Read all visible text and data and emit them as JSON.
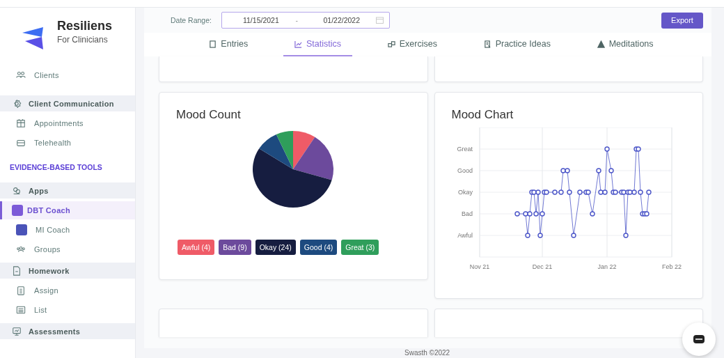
{
  "brand": {
    "name": "Resiliens",
    "subtitle": "For Clinicians"
  },
  "sidebar": {
    "items": [
      {
        "kind": "item",
        "label": "Clients",
        "selected": false
      },
      {
        "kind": "section",
        "label": "Client Communication",
        "selected": false
      },
      {
        "kind": "item",
        "label": "Appointments",
        "selected": false
      },
      {
        "kind": "item",
        "label": "Telehealth",
        "selected": false
      },
      {
        "kind": "heading",
        "label": "EVIDENCE-BASED TOOLS"
      },
      {
        "kind": "section",
        "label": "Apps",
        "selected": false
      },
      {
        "kind": "item",
        "label": "DBT Coach",
        "selected": true
      },
      {
        "kind": "item",
        "label": "MI Coach",
        "selected": false
      },
      {
        "kind": "item",
        "label": "Groups",
        "selected": false
      },
      {
        "kind": "section",
        "label": "Homework",
        "selected": false
      },
      {
        "kind": "item",
        "label": "Assign",
        "selected": false
      },
      {
        "kind": "item",
        "label": "List",
        "selected": false
      },
      {
        "kind": "section",
        "label": "Assessments",
        "selected": false
      }
    ]
  },
  "filter": {
    "label": "Date Range:",
    "start": "11/15/2021",
    "separator": "-",
    "end": "01/22/2022"
  },
  "export_button": "Export",
  "tabs": [
    {
      "label": "Entries",
      "selected": false
    },
    {
      "label": "Statistics",
      "selected": true
    },
    {
      "label": "Exercises",
      "selected": false
    },
    {
      "label": "Practice Ideas",
      "selected": false
    },
    {
      "label": "Meditations",
      "selected": false
    }
  ],
  "mood_count": {
    "chart_data": {
      "type": "pie",
      "title": "Mood Count",
      "categories": [
        "Awful (4)",
        "Bad (9)",
        "Okay (24)",
        "Good (4)",
        "Great (3)"
      ],
      "values": [
        4,
        9,
        24,
        4,
        3
      ],
      "colors": [
        "#ef5b67",
        "#6c4a9c",
        "#161d40",
        "#1d4a7f",
        "#2f9e5b"
      ]
    }
  },
  "mood_chart": {
    "title": "Mood Chart",
    "y_labels": [
      "Great",
      "Good",
      "Okay",
      "Bad",
      "Awful"
    ],
    "x_labels": [
      "Nov 21",
      "Dec 21",
      "Jan 22",
      "Feb 22"
    ]
  },
  "footer": "Swasth ©2022"
}
